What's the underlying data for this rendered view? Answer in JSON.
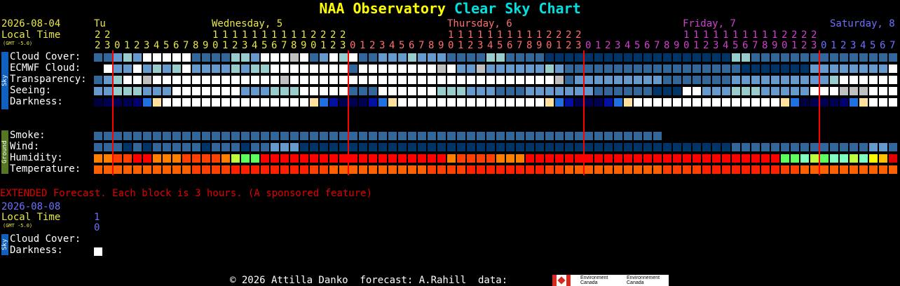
{
  "title": {
    "part1": "NAA Observatory",
    "part2": "Clear Sky Chart"
  },
  "header": {
    "date": "2026-08-04",
    "local_time_label": "Local Time",
    "gmt_label": "(GMT -5.0)",
    "days": [
      {
        "label": "Tu",
        "color": "#e8e84a"
      },
      {
        "label": "Wednesday, 5",
        "color": "#e8e84a"
      },
      {
        "label": "Thursday, 6",
        "color": "#ff6f6f"
      },
      {
        "label": "Friday, 7",
        "color": "#d040d0"
      },
      {
        "label": "Saturday, 8",
        "color": "#6f6fff"
      }
    ],
    "hour_tens": [
      " ",
      " ",
      " ",
      " ",
      " ",
      " ",
      " ",
      " ",
      " ",
      " ",
      "1",
      "1",
      "1",
      "1",
      "1",
      "1",
      "1",
      "1",
      "1",
      "1",
      "2",
      "2",
      "2",
      "2"
    ],
    "start_hours": [
      22,
      23
    ],
    "hours_sequence_first": [
      "2",
      "2"
    ],
    "hours_sequence_second": [
      "2",
      "3"
    ]
  },
  "sky_rows": [
    {
      "label": "Cloud Cover:"
    },
    {
      "label": "ECMWF Cloud:"
    },
    {
      "label": "Transparency:"
    },
    {
      "label": "Seeing:"
    },
    {
      "label": "Darkness:"
    }
  ],
  "ground_rows": [
    {
      "label": "Smoke:"
    },
    {
      "label": "Wind:"
    },
    {
      "label": "Humidity:"
    },
    {
      "label": "Temperature:"
    }
  ],
  "side_labels": {
    "sky": "Sky",
    "ground": "Ground",
    "sky2": "Sky"
  },
  "extended": {
    "note": "EXTENDED Forecast. Each block is 3 hours. (A sponsored feature)",
    "date": "2026-08-08",
    "local_time_label": "Local Time",
    "gmt_label": "(GMT -5.0)",
    "hour_tens": "1",
    "hour_ones": "0",
    "rows": [
      {
        "label": "Cloud Cover:"
      },
      {
        "label": "Darkness:"
      }
    ]
  },
  "footer": {
    "copyright": "© 2026 Attilla Danko  forecast: A.Rahill  data:",
    "logo_en": "Environment\nCanada",
    "logo_fr": "Environnement\nCanada"
  },
  "colors": {
    "cloud_dark": "#003366",
    "cloud_blue": "#336699",
    "cloud_light": "#6699cc",
    "cloud_lighter": "#99cccc",
    "cloud_white": "#ffffff",
    "grey": "#c0c0c0",
    "dark_navy": "#00003f",
    "midnight_line": "#ff0000"
  }
}
